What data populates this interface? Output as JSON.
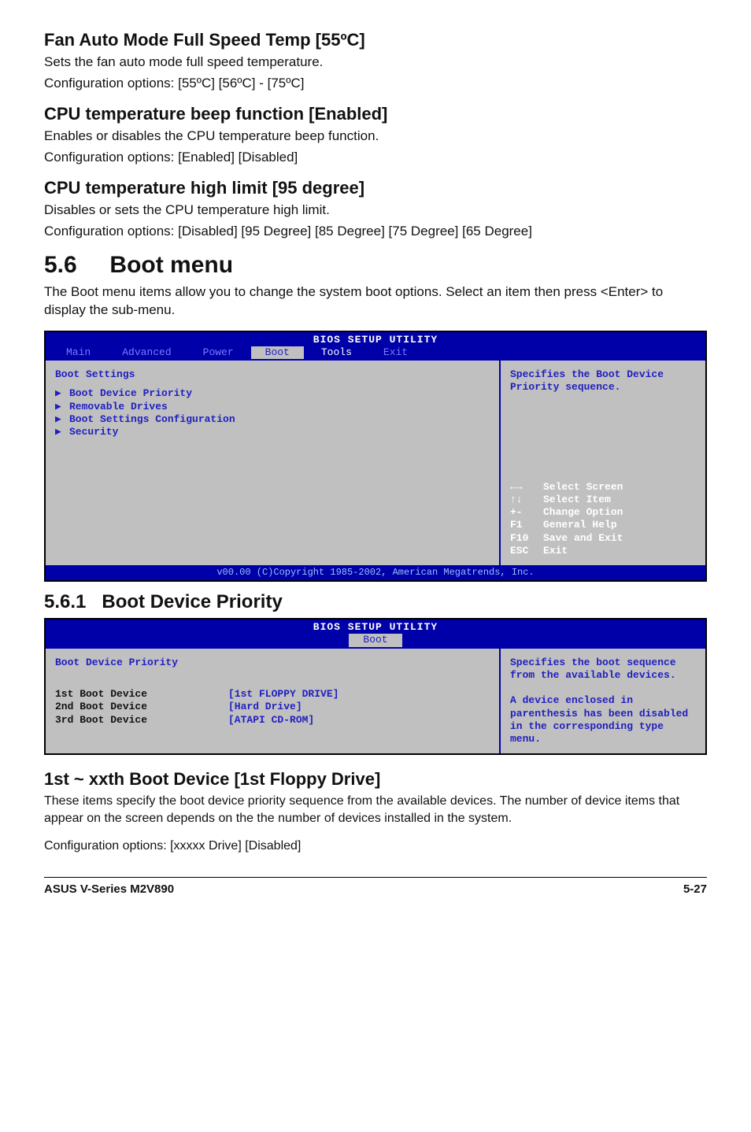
{
  "sections": {
    "fan": {
      "title": "Fan Auto Mode Full Speed Temp [55ºC]",
      "line1": "Sets the fan auto mode full speed temperature.",
      "line2": "Configuration options: [55ºC] [56ºC] - [75ºC]"
    },
    "beep": {
      "title": "CPU temperature beep function [Enabled]",
      "line1": "Enables or disables the CPU temperature beep function.",
      "line2": "Configuration options: [Enabled] [Disabled]"
    },
    "limit": {
      "title": "CPU temperature high limit [95 degree]",
      "line1": "Disables or sets the CPU temperature high limit.",
      "line2": "Configuration options: [Disabled] [95 Degree] [85 Degree] [75 Degree] [65 Degree]"
    },
    "bootmenu": {
      "num": "5.6",
      "title": "Boot menu",
      "desc": "The Boot menu items allow you to change the system boot options. Select an item then press <Enter> to display the sub-menu."
    },
    "priority": {
      "num": "5.6.1",
      "title": "Boot Device Priority"
    },
    "xxth": {
      "title": "1st ~ xxth Boot Device [1st Floppy Drive]",
      "p1": "These items specify the boot device priority sequence from the available devices. The number of device items that appear on the screen depends on the the number of devices installed in the system.",
      "p2": "Configuration options: [xxxxx Drive] [Disabled]"
    }
  },
  "bios1": {
    "title": "BIOS SETUP UTILITY",
    "tabs": [
      "Main",
      "Advanced",
      "Power",
      "Boot",
      "Tools",
      "Exit"
    ],
    "active_tab": 3,
    "heading": "Boot Settings",
    "items": [
      "Boot Device Priority",
      "Removable Drives",
      "Boot Settings Configuration",
      "Security"
    ],
    "help": "Specifies the Boot Device Priority sequence.",
    "keys": [
      {
        "sym": "←→",
        "label": "Select Screen"
      },
      {
        "sym": "↑↓",
        "label": "Select Item"
      },
      {
        "sym": "+-",
        "label": "Change Option"
      },
      {
        "sym": "F1",
        "label": "General Help"
      },
      {
        "sym": "F10",
        "label": "Save and Exit"
      },
      {
        "sym": "ESC",
        "label": "Exit"
      }
    ],
    "footer": "v00.00 (C)Copyright 1985-2002, American Megatrends, Inc."
  },
  "bios2": {
    "title": "BIOS SETUP UTILITY",
    "tab": "Boot",
    "heading": "Boot Device Priority",
    "rows": [
      {
        "k": "1st Boot Device",
        "v": "[1st FLOPPY DRIVE]"
      },
      {
        "k": "2nd Boot Device",
        "v": "[Hard Drive]"
      },
      {
        "k": "3rd Boot Device",
        "v": "[ATAPI CD-ROM]"
      }
    ],
    "help": "Specifies the boot sequence from the available devices.\n\nA device enclosed in parenthesis has been disabled in the corresponding type menu."
  },
  "footer": {
    "left": "ASUS V-Series M2V890",
    "right": "5-27"
  }
}
